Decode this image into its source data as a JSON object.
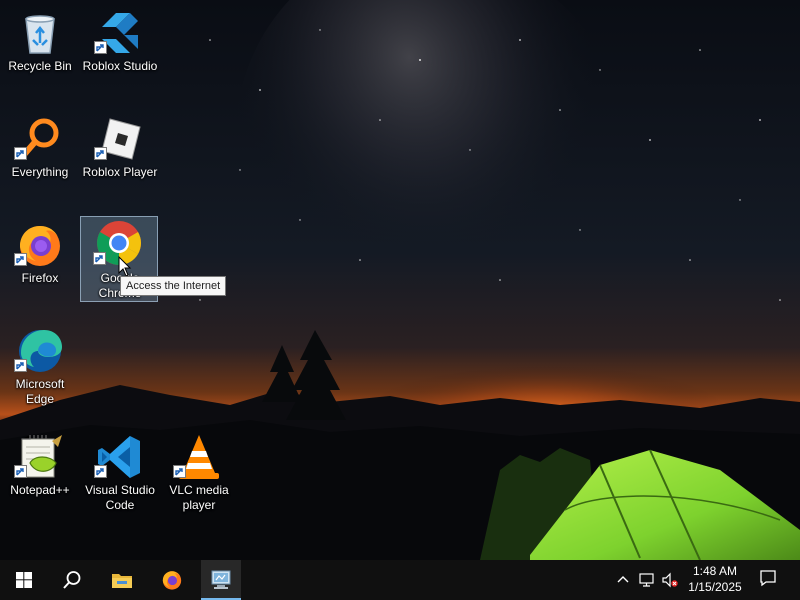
{
  "desktop": {
    "icons": [
      {
        "label": "Recycle Bin",
        "icon": "recycle-bin-icon"
      },
      {
        "label": "Roblox Studio",
        "icon": "roblox-studio-icon"
      },
      {
        "label": "Everything",
        "icon": "everything-icon"
      },
      {
        "label": "Roblox Player",
        "icon": "roblox-player-icon"
      },
      {
        "label": "Firefox",
        "icon": "firefox-icon"
      },
      {
        "label": "Google Chrome",
        "icon": "chrome-icon",
        "selected": true
      },
      {
        "label": "Microsoft Edge",
        "icon": "edge-icon"
      },
      {
        "label": "Notepad++",
        "icon": "notepad-plus-plus-icon"
      },
      {
        "label": "Visual Studio Code",
        "icon": "vscode-icon"
      },
      {
        "label": "VLC media player",
        "icon": "vlc-icon"
      }
    ],
    "tooltip": "Access the Internet"
  },
  "taskbar": {
    "items": [
      {
        "icon": "windows-start-icon"
      },
      {
        "icon": "search-icon"
      },
      {
        "icon": "file-explorer-icon"
      },
      {
        "icon": "firefox-icon"
      },
      {
        "icon": "control-panel-icon",
        "active": true
      }
    ],
    "tray": {
      "icons": [
        "chevron-up-icon",
        "network-icon",
        "volume-muted-icon"
      ],
      "time": "1:48 AM",
      "date": "1/15/2025"
    },
    "notification_icon": "action-center-icon"
  },
  "colors": {
    "taskbar_bg": "#101010",
    "active_indicator": "#76b9ed",
    "tent_green": "#8fe03a",
    "horizon_glow": "#e0641a"
  }
}
